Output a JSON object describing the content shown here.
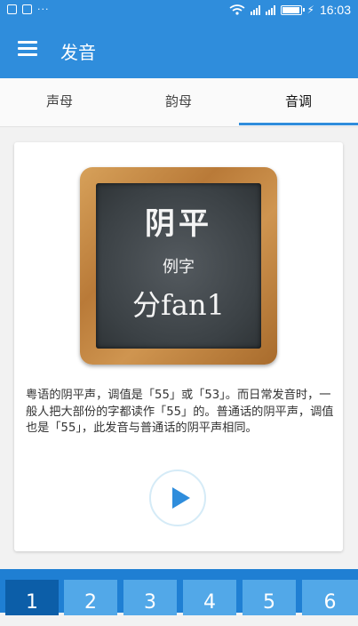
{
  "status_bar": {
    "left_icons": [
      "image-icon",
      "lock-icon"
    ],
    "dots": "···",
    "battery_level": 1.0,
    "time": "16:03"
  },
  "app_bar": {
    "title": "发音"
  },
  "tabs": [
    {
      "label": "声母",
      "selected": false
    },
    {
      "label": "韵母",
      "selected": false
    },
    {
      "label": "音调",
      "selected": true
    }
  ],
  "tone_card": {
    "board_title": "阴平",
    "board_subtitle": "例字",
    "board_example": "分fan1",
    "description": "粤语的阴平声，调值是「55」或「53」。而日常发音时，一般人把大部份的字都读作「55」的。普通话的阴平声，调值也是「55」，此发音与普通话的阴平声相同。"
  },
  "tone_buttons": [
    {
      "label": "1",
      "selected": true
    },
    {
      "label": "2",
      "selected": false
    },
    {
      "label": "3",
      "selected": false
    },
    {
      "label": "4",
      "selected": false
    },
    {
      "label": "5",
      "selected": false
    },
    {
      "label": "6",
      "selected": false
    }
  ],
  "colors": {
    "primary": "#2f8ddc",
    "tone_bar": "#1f7fd3",
    "tone_button": "#52a8e8",
    "tone_button_selected": "#0c5ea8"
  }
}
